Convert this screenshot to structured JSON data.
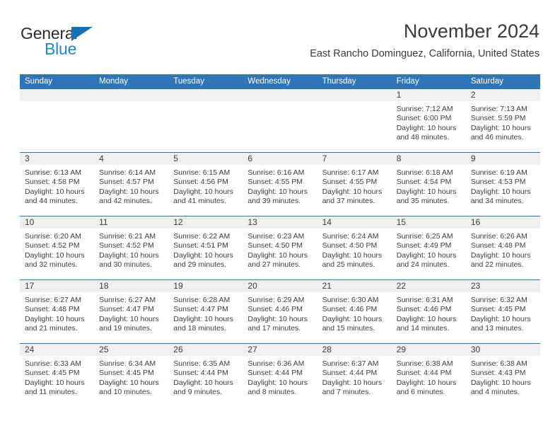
{
  "brand": {
    "name_part1": "General",
    "name_part2": "Blue",
    "triangle_color": "#1072bb",
    "blue_text_color": "#1b85d6"
  },
  "header": {
    "title": "November 2024",
    "subtitle": "East Rancho Dominguez, California, United States",
    "accent_color": "#2f76b8",
    "daynum_band_color": "#f0f0f0"
  },
  "weekday_headers": [
    "Sunday",
    "Monday",
    "Tuesday",
    "Wednesday",
    "Thursday",
    "Friday",
    "Saturday"
  ],
  "weeks": [
    [
      {
        "day": "",
        "sunrise": "",
        "sunset": "",
        "daylight_line1": "",
        "daylight_line2": "",
        "empty": true
      },
      {
        "day": "",
        "sunrise": "",
        "sunset": "",
        "daylight_line1": "",
        "daylight_line2": "",
        "empty": true
      },
      {
        "day": "",
        "sunrise": "",
        "sunset": "",
        "daylight_line1": "",
        "daylight_line2": "",
        "empty": true
      },
      {
        "day": "",
        "sunrise": "",
        "sunset": "",
        "daylight_line1": "",
        "daylight_line2": "",
        "empty": true
      },
      {
        "day": "",
        "sunrise": "",
        "sunset": "",
        "daylight_line1": "",
        "daylight_line2": "",
        "empty": true
      },
      {
        "day": "1",
        "sunrise": "Sunrise: 7:12 AM",
        "sunset": "Sunset: 6:00 PM",
        "daylight_line1": "Daylight: 10 hours",
        "daylight_line2": "and 48 minutes.",
        "empty": false
      },
      {
        "day": "2",
        "sunrise": "Sunrise: 7:13 AM",
        "sunset": "Sunset: 5:59 PM",
        "daylight_line1": "Daylight: 10 hours",
        "daylight_line2": "and 46 minutes.",
        "empty": false
      }
    ],
    [
      {
        "day": "3",
        "sunrise": "Sunrise: 6:13 AM",
        "sunset": "Sunset: 4:58 PM",
        "daylight_line1": "Daylight: 10 hours",
        "daylight_line2": "and 44 minutes.",
        "empty": false
      },
      {
        "day": "4",
        "sunrise": "Sunrise: 6:14 AM",
        "sunset": "Sunset: 4:57 PM",
        "daylight_line1": "Daylight: 10 hours",
        "daylight_line2": "and 42 minutes.",
        "empty": false
      },
      {
        "day": "5",
        "sunrise": "Sunrise: 6:15 AM",
        "sunset": "Sunset: 4:56 PM",
        "daylight_line1": "Daylight: 10 hours",
        "daylight_line2": "and 41 minutes.",
        "empty": false
      },
      {
        "day": "6",
        "sunrise": "Sunrise: 6:16 AM",
        "sunset": "Sunset: 4:55 PM",
        "daylight_line1": "Daylight: 10 hours",
        "daylight_line2": "and 39 minutes.",
        "empty": false
      },
      {
        "day": "7",
        "sunrise": "Sunrise: 6:17 AM",
        "sunset": "Sunset: 4:55 PM",
        "daylight_line1": "Daylight: 10 hours",
        "daylight_line2": "and 37 minutes.",
        "empty": false
      },
      {
        "day": "8",
        "sunrise": "Sunrise: 6:18 AM",
        "sunset": "Sunset: 4:54 PM",
        "daylight_line1": "Daylight: 10 hours",
        "daylight_line2": "and 35 minutes.",
        "empty": false
      },
      {
        "day": "9",
        "sunrise": "Sunrise: 6:19 AM",
        "sunset": "Sunset: 4:53 PM",
        "daylight_line1": "Daylight: 10 hours",
        "daylight_line2": "and 34 minutes.",
        "empty": false
      }
    ],
    [
      {
        "day": "10",
        "sunrise": "Sunrise: 6:20 AM",
        "sunset": "Sunset: 4:52 PM",
        "daylight_line1": "Daylight: 10 hours",
        "daylight_line2": "and 32 minutes.",
        "empty": false
      },
      {
        "day": "11",
        "sunrise": "Sunrise: 6:21 AM",
        "sunset": "Sunset: 4:52 PM",
        "daylight_line1": "Daylight: 10 hours",
        "daylight_line2": "and 30 minutes.",
        "empty": false
      },
      {
        "day": "12",
        "sunrise": "Sunrise: 6:22 AM",
        "sunset": "Sunset: 4:51 PM",
        "daylight_line1": "Daylight: 10 hours",
        "daylight_line2": "and 29 minutes.",
        "empty": false
      },
      {
        "day": "13",
        "sunrise": "Sunrise: 6:23 AM",
        "sunset": "Sunset: 4:50 PM",
        "daylight_line1": "Daylight: 10 hours",
        "daylight_line2": "and 27 minutes.",
        "empty": false
      },
      {
        "day": "14",
        "sunrise": "Sunrise: 6:24 AM",
        "sunset": "Sunset: 4:50 PM",
        "daylight_line1": "Daylight: 10 hours",
        "daylight_line2": "and 25 minutes.",
        "empty": false
      },
      {
        "day": "15",
        "sunrise": "Sunrise: 6:25 AM",
        "sunset": "Sunset: 4:49 PM",
        "daylight_line1": "Daylight: 10 hours",
        "daylight_line2": "and 24 minutes.",
        "empty": false
      },
      {
        "day": "16",
        "sunrise": "Sunrise: 6:26 AM",
        "sunset": "Sunset: 4:48 PM",
        "daylight_line1": "Daylight: 10 hours",
        "daylight_line2": "and 22 minutes.",
        "empty": false
      }
    ],
    [
      {
        "day": "17",
        "sunrise": "Sunrise: 6:27 AM",
        "sunset": "Sunset: 4:48 PM",
        "daylight_line1": "Daylight: 10 hours",
        "daylight_line2": "and 21 minutes.",
        "empty": false
      },
      {
        "day": "18",
        "sunrise": "Sunrise: 6:27 AM",
        "sunset": "Sunset: 4:47 PM",
        "daylight_line1": "Daylight: 10 hours",
        "daylight_line2": "and 19 minutes.",
        "empty": false
      },
      {
        "day": "19",
        "sunrise": "Sunrise: 6:28 AM",
        "sunset": "Sunset: 4:47 PM",
        "daylight_line1": "Daylight: 10 hours",
        "daylight_line2": "and 18 minutes.",
        "empty": false
      },
      {
        "day": "20",
        "sunrise": "Sunrise: 6:29 AM",
        "sunset": "Sunset: 4:46 PM",
        "daylight_line1": "Daylight: 10 hours",
        "daylight_line2": "and 17 minutes.",
        "empty": false
      },
      {
        "day": "21",
        "sunrise": "Sunrise: 6:30 AM",
        "sunset": "Sunset: 4:46 PM",
        "daylight_line1": "Daylight: 10 hours",
        "daylight_line2": "and 15 minutes.",
        "empty": false
      },
      {
        "day": "22",
        "sunrise": "Sunrise: 6:31 AM",
        "sunset": "Sunset: 4:46 PM",
        "daylight_line1": "Daylight: 10 hours",
        "daylight_line2": "and 14 minutes.",
        "empty": false
      },
      {
        "day": "23",
        "sunrise": "Sunrise: 6:32 AM",
        "sunset": "Sunset: 4:45 PM",
        "daylight_line1": "Daylight: 10 hours",
        "daylight_line2": "and 13 minutes.",
        "empty": false
      }
    ],
    [
      {
        "day": "24",
        "sunrise": "Sunrise: 6:33 AM",
        "sunset": "Sunset: 4:45 PM",
        "daylight_line1": "Daylight: 10 hours",
        "daylight_line2": "and 11 minutes.",
        "empty": false
      },
      {
        "day": "25",
        "sunrise": "Sunrise: 6:34 AM",
        "sunset": "Sunset: 4:45 PM",
        "daylight_line1": "Daylight: 10 hours",
        "daylight_line2": "and 10 minutes.",
        "empty": false
      },
      {
        "day": "26",
        "sunrise": "Sunrise: 6:35 AM",
        "sunset": "Sunset: 4:44 PM",
        "daylight_line1": "Daylight: 10 hours",
        "daylight_line2": "and 9 minutes.",
        "empty": false
      },
      {
        "day": "27",
        "sunrise": "Sunrise: 6:36 AM",
        "sunset": "Sunset: 4:44 PM",
        "daylight_line1": "Daylight: 10 hours",
        "daylight_line2": "and 8 minutes.",
        "empty": false
      },
      {
        "day": "28",
        "sunrise": "Sunrise: 6:37 AM",
        "sunset": "Sunset: 4:44 PM",
        "daylight_line1": "Daylight: 10 hours",
        "daylight_line2": "and 7 minutes.",
        "empty": false
      },
      {
        "day": "29",
        "sunrise": "Sunrise: 6:38 AM",
        "sunset": "Sunset: 4:44 PM",
        "daylight_line1": "Daylight: 10 hours",
        "daylight_line2": "and 6 minutes.",
        "empty": false
      },
      {
        "day": "30",
        "sunrise": "Sunrise: 6:38 AM",
        "sunset": "Sunset: 4:43 PM",
        "daylight_line1": "Daylight: 10 hours",
        "daylight_line2": "and 4 minutes.",
        "empty": false
      }
    ]
  ]
}
